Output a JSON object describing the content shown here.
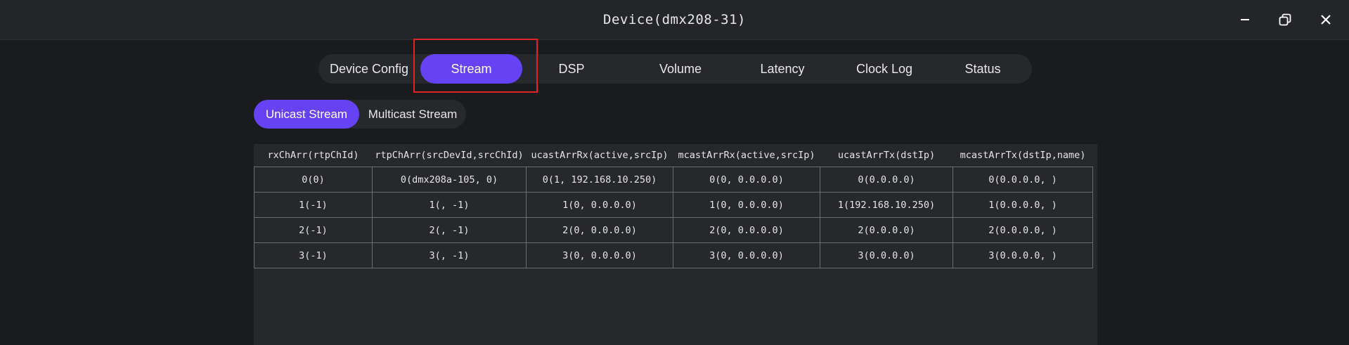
{
  "window": {
    "title": "Device(dmx208-31)",
    "minimize_icon": "minimize-icon",
    "restore_icon": "restore-icon",
    "close_icon": "close-icon"
  },
  "tabs": [
    {
      "label": "Device Config"
    },
    {
      "label": "Stream",
      "active": true
    },
    {
      "label": "DSP"
    },
    {
      "label": "Volume"
    },
    {
      "label": "Latency"
    },
    {
      "label": "Clock Log"
    },
    {
      "label": "Status"
    }
  ],
  "subtabs": [
    {
      "label": "Unicast Stream",
      "active": true
    },
    {
      "label": "Multicast Stream"
    }
  ],
  "table": {
    "headers": [
      "rxChArr(rtpChId)",
      "rtpChArr(srcDevId,srcChId)",
      "ucastArrRx(active,srcIp)",
      "mcastArrRx(active,srcIp)",
      "ucastArrTx(dstIp)",
      "mcastArrTx(dstIp,name)"
    ],
    "rows": [
      [
        "0(0)",
        "0(dmx208a-105, 0)",
        "0(1, 192.168.10.250)",
        "0(0, 0.0.0.0)",
        "0(0.0.0.0)",
        "0(0.0.0.0, )"
      ],
      [
        "1(-1)",
        "1(, -1)",
        "1(0, 0.0.0.0)",
        "1(0, 0.0.0.0)",
        "1(192.168.10.250)",
        "1(0.0.0.0, )"
      ],
      [
        "2(-1)",
        "2(, -1)",
        "2(0, 0.0.0.0)",
        "2(0, 0.0.0.0)",
        "2(0.0.0.0)",
        "2(0.0.0.0, )"
      ],
      [
        "3(-1)",
        "3(, -1)",
        "3(0, 0.0.0.0)",
        "3(0, 0.0.0.0)",
        "3(0.0.0.0)",
        "3(0.0.0.0, )"
      ]
    ]
  },
  "colors": {
    "accent": "#6543f5",
    "highlight": "#e02424",
    "background": "#1a1b1e",
    "panel": "#27282c"
  }
}
